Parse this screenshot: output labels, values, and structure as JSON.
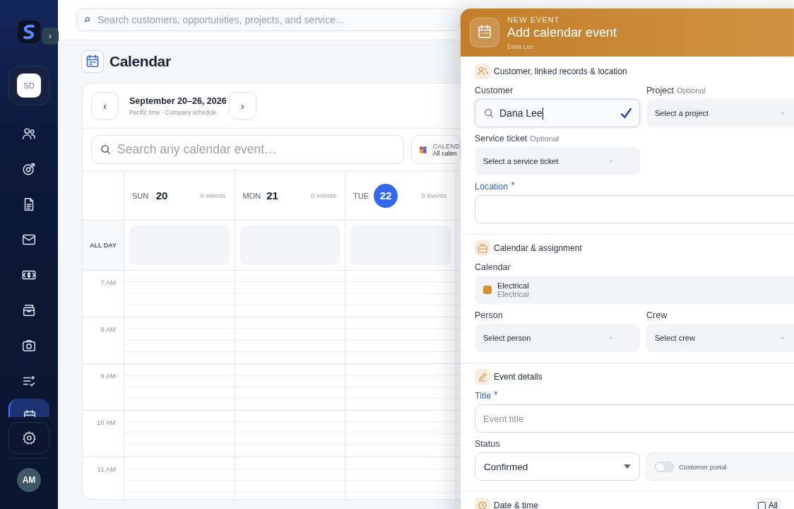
{
  "sidebar": {
    "expand": "›",
    "workspace": "SD",
    "nav": [
      {
        "selected": false
      },
      {
        "selected": false
      },
      {
        "selected": false
      },
      {
        "selected": false
      },
      {
        "selected": false
      },
      {
        "selected": false
      },
      {
        "selected": false
      },
      {
        "selected": false
      },
      {
        "selected": true
      }
    ],
    "avatar": "AM"
  },
  "search": {
    "placeholder": "Search customers, opportunities, projects, and service…"
  },
  "page": {
    "title": "Calendar"
  },
  "toolbar": {
    "prev": "‹",
    "range": "September 20–26, 2026",
    "subtitle": "Pacific time · Company schedule",
    "next": "›"
  },
  "event_search": {
    "placeholder": "Search any calendar event…"
  },
  "calendar_filter": {
    "label": "CALEND",
    "value": "All calen"
  },
  "days": [
    {
      "weekday": "SUN",
      "date": "20",
      "count": "0 events",
      "selected": false
    },
    {
      "weekday": "MON",
      "date": "21",
      "count": "0 events",
      "selected": false
    },
    {
      "weekday": "TUE",
      "date": "22",
      "count": "0 events",
      "selected": true
    }
  ],
  "all_day_label": "ALL DAY",
  "hours": [
    "7 AM",
    "8 AM",
    "9 AM",
    "10 AM",
    "11 AM"
  ],
  "panel": {
    "eyebrow": "NEW EVENT",
    "title": "Add calendar event",
    "subtitle": "Dana Lee",
    "customer_section": {
      "heading": "Customer, linked records & location"
    },
    "customer": {
      "label": "Customer",
      "value": "Dana Lee",
      "verified": true
    },
    "project": {
      "label": "Project",
      "hint": "Optional",
      "value": "Select a project"
    },
    "service_ticket": {
      "label": "Service ticket",
      "hint": "Optional",
      "value": "Select a service ticket"
    },
    "location": {
      "label": "Location",
      "required_mark": "*"
    },
    "assignment_section": {
      "heading": "Calendar & assignment"
    },
    "calendar": {
      "label": "Calendar",
      "name": "Electrical",
      "group": "Electrical"
    },
    "person": {
      "label": "Person",
      "value": "Select person"
    },
    "crew": {
      "label": "Crew",
      "value": "Select crew"
    },
    "details_section": {
      "heading": "Event details"
    },
    "title_field": {
      "label": "Title",
      "required_mark": "*",
      "placeholder": "Event title"
    },
    "status": {
      "label": "Status",
      "value": "Confirmed"
    },
    "customer_portal": {
      "label": "Customer portal",
      "on": false
    },
    "datetime_section": {
      "heading": "Date & time"
    },
    "all_day": {
      "label": "All",
      "checked": false
    }
  }
}
